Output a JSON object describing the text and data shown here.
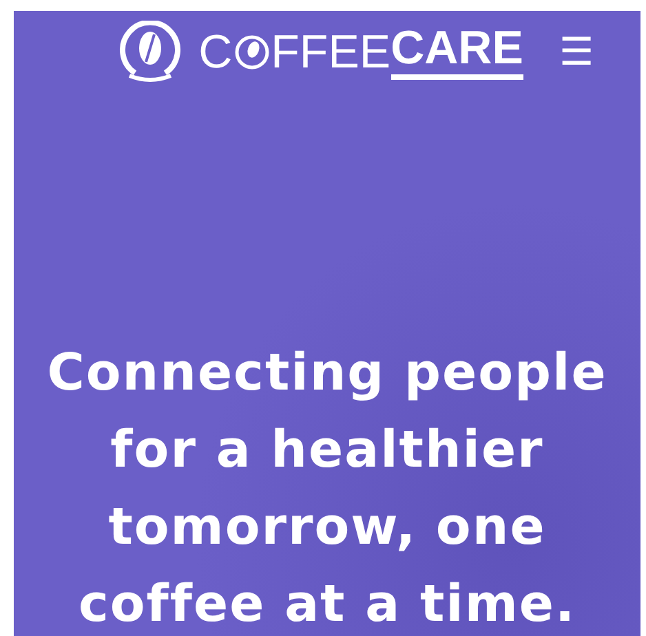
{
  "header": {
    "logo": {
      "part_1": "C",
      "part_2": "FFEE",
      "part_3": "CARE"
    },
    "menu_icon": "☰"
  },
  "hero": {
    "headline": "Connecting people for a healthier tomorrow, one coffee at a time."
  }
}
